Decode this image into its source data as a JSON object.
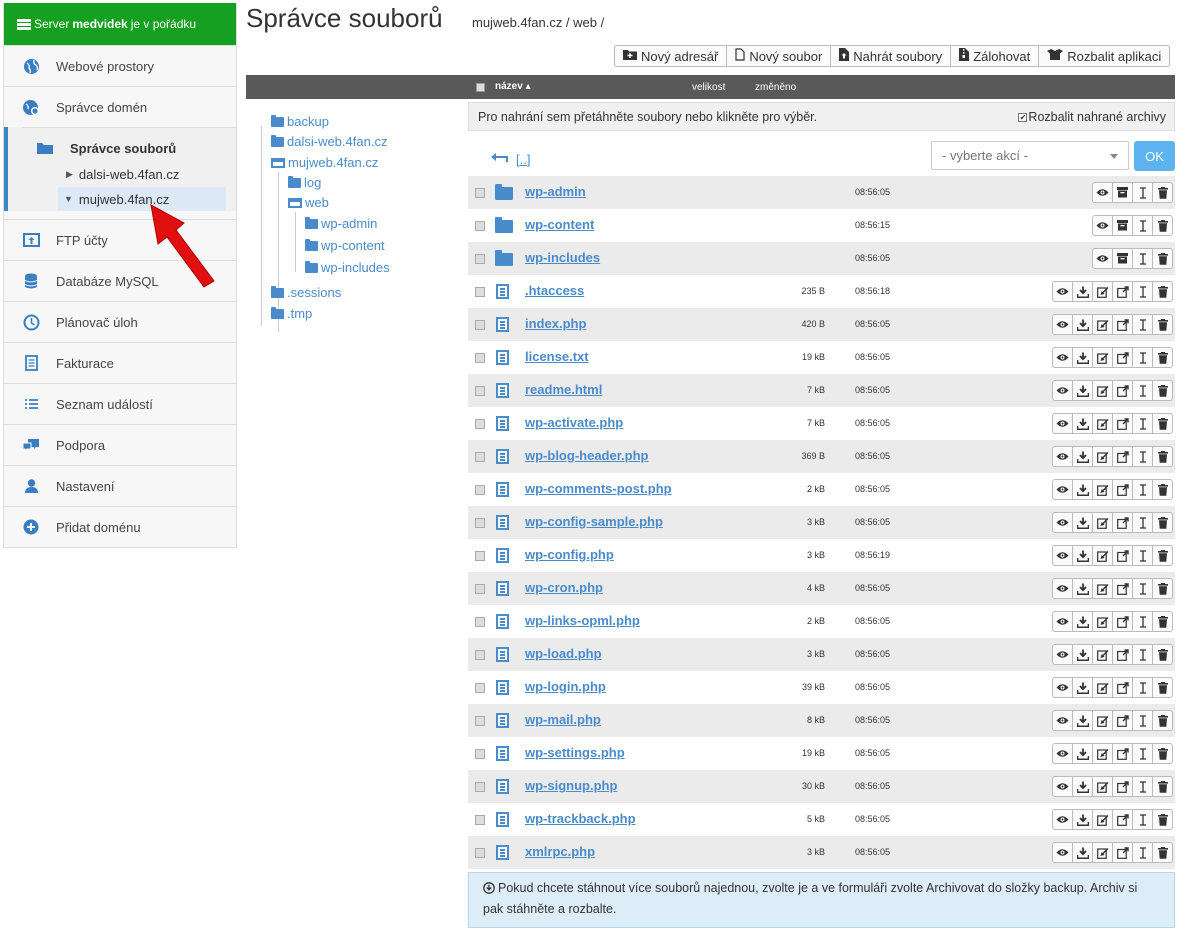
{
  "server_status": {
    "prefix": "Server",
    "name": "medvidek",
    "suffix": "je v pořádku"
  },
  "sidebar": {
    "items": [
      {
        "label": "Webové prostory",
        "icon": "globe-icon"
      },
      {
        "label": "Správce domén",
        "icon": "domain-icon"
      }
    ],
    "active": {
      "label": "Správce souborů",
      "icon": "folder-open-icon",
      "subitems": [
        {
          "label": "dalsi-web.4fan.cz",
          "tri": "▶"
        },
        {
          "label": "mujweb.4fan.cz",
          "tri": "▼"
        }
      ]
    },
    "items_after": [
      {
        "label": "FTP účty",
        "icon": "upload-icon"
      },
      {
        "label": "Databáze MySQL",
        "icon": "database-icon"
      },
      {
        "label": "Plánovač úloh",
        "icon": "clock-icon"
      },
      {
        "label": "Fakturace",
        "icon": "invoice-icon"
      },
      {
        "label": "Seznam událostí",
        "icon": "list-icon"
      },
      {
        "label": "Podpora",
        "icon": "chat-icon"
      },
      {
        "label": "Nastavení",
        "icon": "user-icon"
      },
      {
        "label": "Přidat doménu",
        "icon": "plus-circle-icon"
      }
    ]
  },
  "header": {
    "title": "Správce souborů",
    "breadcrumb": "mujweb.4fan.cz / web /"
  },
  "toolbar": {
    "new_dir": "Nový adresář",
    "new_file": "Nový soubor",
    "upload": "Nahrát soubory",
    "backup": "Zálohovat",
    "unpack": "Rozbalit aplikaci"
  },
  "list_header": {
    "name": "název",
    "size": "velikost",
    "date": "změněno"
  },
  "tree": [
    {
      "label": "backup",
      "type": "folder"
    },
    {
      "label": "dalsi-web.4fan.cz",
      "type": "folder"
    },
    {
      "label": "mujweb.4fan.cz",
      "type": "open"
    },
    {
      "label": "log",
      "type": "folder"
    },
    {
      "label": "web",
      "type": "open"
    },
    {
      "label": "wp-admin",
      "type": "folder"
    },
    {
      "label": "wp-content",
      "type": "folder"
    },
    {
      "label": "wp-includes",
      "type": "folder"
    },
    {
      "label": ".sessions",
      "type": "folder"
    },
    {
      "label": ".tmp",
      "type": "folder"
    }
  ],
  "dropzone": {
    "text": "Pro nahrání sem přetáhněte soubory nebo klikněte pro výběr.",
    "extract": "Rozbalit nahrané archivy"
  },
  "up_link": "[..]",
  "action_select": {
    "placeholder": "- vyberte akcí -"
  },
  "ok_label": "OK",
  "files": [
    {
      "name": "wp-admin",
      "size": "",
      "date": "08:56:05",
      "type": "folder"
    },
    {
      "name": "wp-content",
      "size": "",
      "date": "08:56:15",
      "type": "folder"
    },
    {
      "name": "wp-includes",
      "size": "",
      "date": "08:56:05",
      "type": "folder"
    },
    {
      "name": ".htaccess",
      "size": "235 B",
      "date": "08:56:18",
      "type": "file"
    },
    {
      "name": "index.php",
      "size": "420 B",
      "date": "08:56:05",
      "type": "file"
    },
    {
      "name": "license.txt",
      "size": "19 kB",
      "date": "08:56:05",
      "type": "file"
    },
    {
      "name": "readme.html",
      "size": "7 kB",
      "date": "08:56:05",
      "type": "file"
    },
    {
      "name": "wp-activate.php",
      "size": "7 kB",
      "date": "08:56:05",
      "type": "file"
    },
    {
      "name": "wp-blog-header.php",
      "size": "369 B",
      "date": "08:56:05",
      "type": "file"
    },
    {
      "name": "wp-comments-post.php",
      "size": "2 kB",
      "date": "08:56:05",
      "type": "file"
    },
    {
      "name": "wp-config-sample.php",
      "size": "3 kB",
      "date": "08:56:05",
      "type": "file"
    },
    {
      "name": "wp-config.php",
      "size": "3 kB",
      "date": "08:56:19",
      "type": "file"
    },
    {
      "name": "wp-cron.php",
      "size": "4 kB",
      "date": "08:56:05",
      "type": "file"
    },
    {
      "name": "wp-links-opml.php",
      "size": "2 kB",
      "date": "08:56:05",
      "type": "file"
    },
    {
      "name": "wp-load.php",
      "size": "3 kB",
      "date": "08:56:05",
      "type": "file"
    },
    {
      "name": "wp-login.php",
      "size": "39 kB",
      "date": "08:56:05",
      "type": "file"
    },
    {
      "name": "wp-mail.php",
      "size": "8 kB",
      "date": "08:56:05",
      "type": "file"
    },
    {
      "name": "wp-settings.php",
      "size": "19 kB",
      "date": "08:56:05",
      "type": "file"
    },
    {
      "name": "wp-signup.php",
      "size": "30 kB",
      "date": "08:56:05",
      "type": "file"
    },
    {
      "name": "wp-trackback.php",
      "size": "5 kB",
      "date": "08:56:05",
      "type": "file"
    },
    {
      "name": "xmlrpc.php",
      "size": "3 kB",
      "date": "08:56:05",
      "type": "file"
    }
  ],
  "info": "Pokud chcete stáhnout více souborů najednou, zvolte je a ve formuláři zvolte Archivovat do složky backup. Archiv si pak stáhněte a rozbalte.",
  "colors": {
    "status_green": "#16a021",
    "accent_blue": "#4a8bcb",
    "ok_button": "#5cb3f0",
    "arrow_red": "#e01010"
  }
}
